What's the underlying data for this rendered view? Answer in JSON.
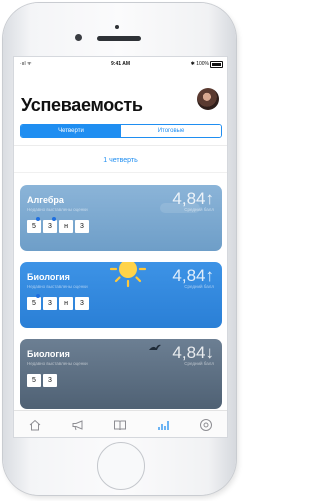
{
  "status_bar": {
    "carrier": "·ııl ᯤ",
    "time": "9:41 AM",
    "battery": "✱ 100%"
  },
  "header": {
    "title": "Успеваемость"
  },
  "segmented": {
    "tabs": [
      "Четверти",
      "Итоговые"
    ],
    "selected": "Четверти"
  },
  "period": {
    "label": "1 четверть"
  },
  "cards": [
    {
      "subject": "Алгебра",
      "subtitle": "Недавно выставлены оценки",
      "average": "4,84↑",
      "average_label": "Средний балл",
      "grades": [
        "5",
        "3",
        "н",
        "3"
      ],
      "new_marks": [
        0,
        1
      ],
      "color": "#7fa9d0"
    },
    {
      "subject": "Биология",
      "subtitle": "Недавно выставлены оценки",
      "average": "4,84↑",
      "average_label": "Средний балл",
      "grades": [
        "5",
        "3",
        "н",
        "3"
      ],
      "new_marks": [
        0
      ],
      "color": "#3a8fe4"
    },
    {
      "subject": "Биология",
      "subtitle": "Недавно выставлены оценки",
      "average": "4,84↓",
      "average_label": "Средний балл",
      "grades": [
        "5",
        "3"
      ],
      "new_marks": [],
      "color": "#5d6f83"
    }
  ],
  "tabbar": {
    "items": [
      "home-icon",
      "megaphone-icon",
      "book-icon",
      "chart-icon",
      "profile-icon"
    ],
    "active": "chart-icon",
    "active_color": "#1f8ef1",
    "inactive_color": "#8e8e93"
  }
}
